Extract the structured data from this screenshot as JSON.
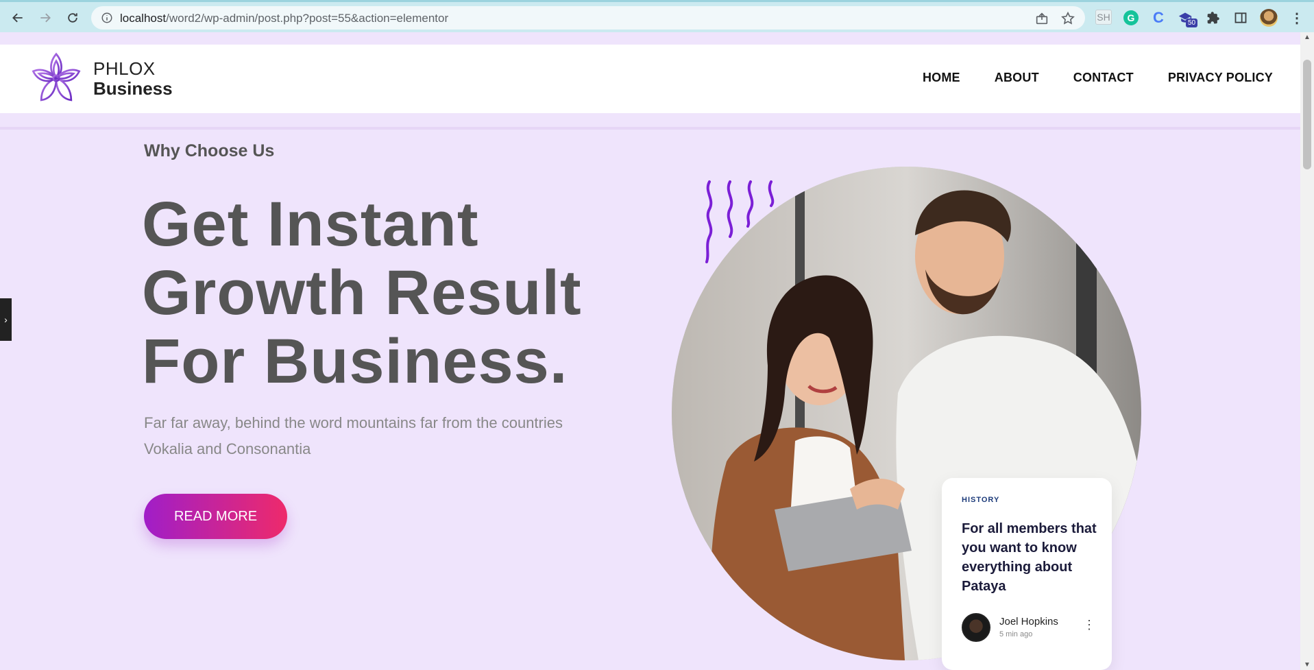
{
  "browser": {
    "url_host": "localhost",
    "url_path": "/word2/wp-admin/post.php?post=55&action=elementor",
    "extensions": {
      "sh_label": "SH",
      "grammarly_label": "G",
      "c_label": "C",
      "badge_count": "50"
    },
    "icons": [
      "back-icon",
      "forward-icon",
      "reload-icon",
      "info-icon",
      "share-icon",
      "star-icon",
      "puzzle-icon",
      "sidepanel-icon",
      "menu-icon"
    ]
  },
  "site": {
    "brand_top": "PHLOX",
    "brand_bottom": "Business",
    "menu": [
      "HOME",
      "ABOUT",
      "CONTACT",
      "PRIVACY POLICY"
    ],
    "accent": "#a01ec8",
    "accent2": "#ee2a6b",
    "background": "#efe4fc"
  },
  "hero": {
    "eyebrow": "Why Choose Us",
    "headline_lines": [
      "Get Instant",
      "Growth Result",
      "For Business."
    ],
    "description": "Far far away, behind the word mountains far from the countries Vokalia and Consonantia",
    "cta_label": "READ MORE"
  },
  "card": {
    "category": "HISTORY",
    "title": "For all members that you want to know everything about Pataya",
    "author": "Joel Hopkins",
    "time": "5 min ago"
  }
}
